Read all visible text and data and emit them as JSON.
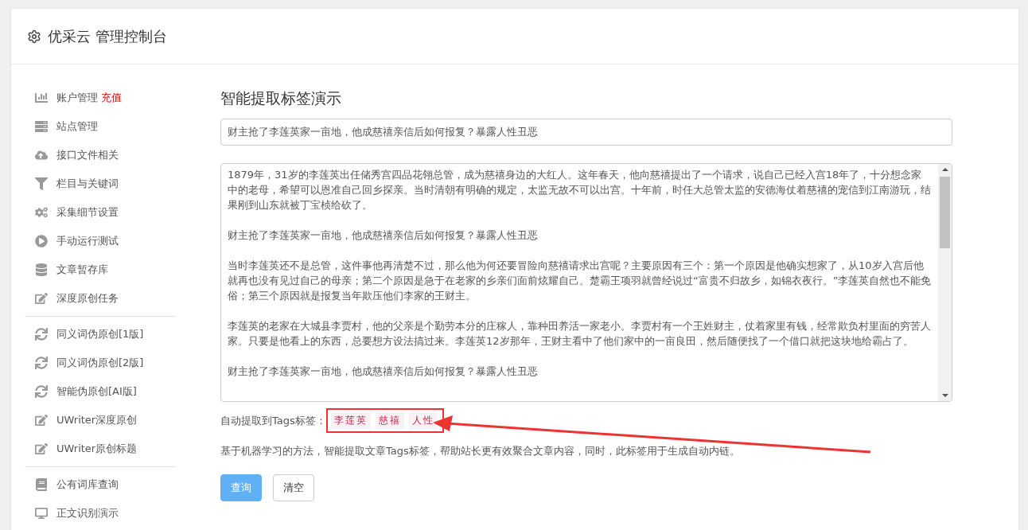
{
  "header": {
    "title": "优采云 管理控制台"
  },
  "sidebar": {
    "groups": [
      [
        {
          "label": "账户管理",
          "badge": "充值"
        },
        {
          "label": "站点管理"
        },
        {
          "label": "接口文件相关"
        },
        {
          "label": "栏目与关键词"
        },
        {
          "label": "采集细节设置"
        },
        {
          "label": "手动运行测试"
        },
        {
          "label": "文章暂存库"
        },
        {
          "label": "深度原创任务"
        }
      ],
      [
        {
          "label": "同义词伪原创[1版]"
        },
        {
          "label": "同义词伪原创[2版]"
        },
        {
          "label": "智能伪原创[AI版]"
        },
        {
          "label": "UWriter深度原创"
        },
        {
          "label": "UWriter原创标题"
        }
      ],
      [
        {
          "label": "公有词库查询"
        },
        {
          "label": "正文识别演示"
        }
      ]
    ]
  },
  "main": {
    "title": "智能提取标签演示",
    "title_field": {
      "value": "财主抢了李莲英家一亩地，他成慈禧亲信后如何报复？暴露人性丑恶"
    },
    "content_paragraphs": [
      "1879年，31岁的李莲英出任储秀宫四品花翎总管，成为慈禧身边的大红人。这年春天，他向慈禧提出了一个请求，说自己已经入宫18年了，十分想念家中的老母，希望可以恩准自己回乡探亲。当时清朝有明确的规定，太监无故不可以出宫。十年前，时任大总管太监的安德海仗着慈禧的宠信到江南游玩，结果刚到山东就被丁宝桢给砍了。",
      "财主抢了李莲英家一亩地，他成慈禧亲信后如何报复？暴露人性丑恶",
      "当时李莲英还不是总管，这件事他再清楚不过，那么他为何还要冒险向慈禧请求出宫呢？主要原因有三个：第一个原因是他确实想家了，从10岁入宫后他就再也没有见过自己的母亲；第二个原因是急于在老家的乡亲们面前炫耀自己。楚霸王项羽就曾经说过“富贵不归故乡，如锦衣夜行。”李莲英自然也不能免俗；第三个原因就是报复当年欺压他们李家的王财主。",
      "李莲英的老家在大城县李贾村，他的父亲是个勤劳本分的庄稼人，靠种田养活一家老小。李贾村有一个王姓财主，仗着家里有钱，经常欺负村里面的穷苦人家。只要是他看上的东西，总要想方设法搞过来。李莲英12岁那年，王财主看中了他们家中的一亩良田，然后随便找了一个借口就把这块地给霸占了。",
      "财主抢了李莲英家一亩地，他成慈禧亲信后如何报复？暴露人性丑恶"
    ],
    "tags_label": "自动提取到Tags标签：",
    "tags": [
      "李莲英",
      "慈禧",
      "人性"
    ],
    "description": "基于机器学习的方法，智能提取文章Tags标签，帮助站长更有效聚合文章内容，同时，此标签用于生成自动内链。",
    "buttons": [
      {
        "label": "查询",
        "kind": "primary"
      },
      {
        "label": "清空",
        "kind": "default"
      }
    ]
  }
}
